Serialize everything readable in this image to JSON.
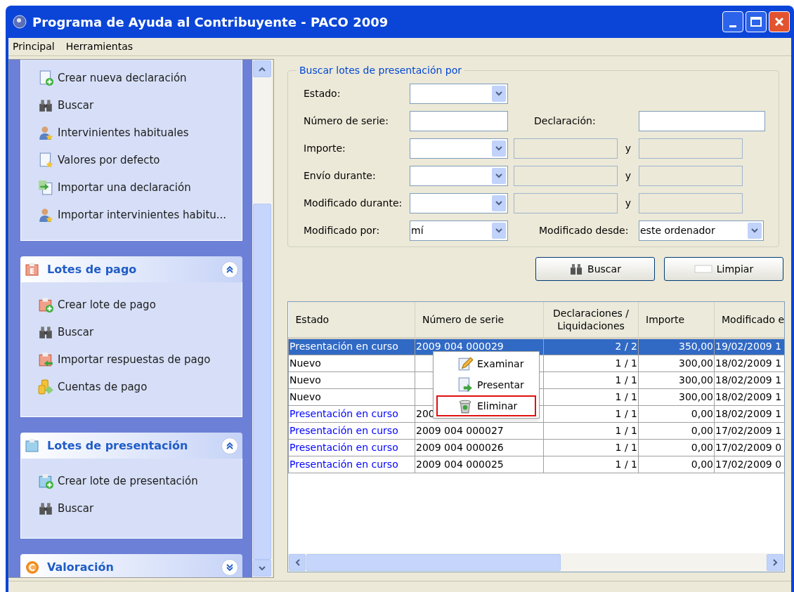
{
  "window": {
    "title": "Programa de Ayuda al Contribuyente - PACO 2009"
  },
  "menu_bar": [
    "Principal",
    "Herramientas"
  ],
  "sidebar": {
    "sections": [
      {
        "items": [
          "Crear nueva declaración",
          "Buscar",
          "Intervinientes habituales",
          "Valores por defecto",
          "Importar una declaración",
          "Importar intervinientes habitu..."
        ]
      },
      {
        "title": "Lotes de pago",
        "expanded": true,
        "items": [
          "Crear lote de pago",
          "Buscar",
          "Importar respuestas de pago",
          "Cuentas de pago"
        ]
      },
      {
        "title": "Lotes de presentación",
        "expanded": true,
        "items": [
          "Crear lote de presentación",
          "Buscar"
        ]
      },
      {
        "title": "Valoración",
        "expanded": false
      }
    ]
  },
  "search_form": {
    "legend": "Buscar lotes de presentación por",
    "estado": {
      "label": "Estado:"
    },
    "numero_serie": {
      "label": "Número de serie:"
    },
    "declaracion": {
      "label": "Declaración:"
    },
    "importe": {
      "label": "Importe:",
      "between": "y"
    },
    "envio_durante": {
      "label": "Envío durante:",
      "between": "y"
    },
    "modificado_durante": {
      "label": "Modificado durante:",
      "between": "y"
    },
    "modificado_por": {
      "label": "Modificado por:",
      "value": "mí"
    },
    "modificado_desde": {
      "label": "Modificado desde:",
      "value": "este ordenador"
    },
    "buttons": [
      "Buscar",
      "Limpiar"
    ]
  },
  "table": {
    "columns": [
      "Estado",
      "Número de serie",
      "Declaraciones / Liquidaciones",
      "Importe",
      "Modificado e"
    ],
    "rows": [
      {
        "selected": true,
        "color": "#ffffff",
        "cells": [
          "Presentación en curso",
          "2009 004 000029",
          "2 / 2",
          "350,00",
          "19/02/2009 1"
        ]
      },
      {
        "selected": false,
        "color": "#000000",
        "cells": [
          "Nuevo",
          "",
          "1 / 1",
          "300,00",
          "18/02/2009 1"
        ]
      },
      {
        "selected": false,
        "color": "#000000",
        "cells": [
          "Nuevo",
          "",
          "1 / 1",
          "300,00",
          "18/02/2009 1"
        ]
      },
      {
        "selected": false,
        "color": "#000000",
        "cells": [
          "Nuevo",
          "",
          "1 / 1",
          "300,00",
          "18/02/2009 1"
        ]
      },
      {
        "selected": false,
        "color": "#0000ff",
        "cells": [
          "Presentación en curso",
          "200",
          "1 / 1",
          "0,00",
          "18/02/2009 1"
        ]
      },
      {
        "selected": false,
        "color": "#0000ff",
        "cells": [
          "Presentación en curso",
          "2009 004 000027",
          "1 / 1",
          "0,00",
          "17/02/2009 1"
        ]
      },
      {
        "selected": false,
        "color": "#0000ff",
        "cells": [
          "Presentación en curso",
          "2009 004 000026",
          "1 / 1",
          "0,00",
          "17/02/2009 0"
        ]
      },
      {
        "selected": false,
        "color": "#0000ff",
        "cells": [
          "Presentación en curso",
          "2009 004 000025",
          "1 / 1",
          "0,00",
          "17/02/2009 0"
        ]
      }
    ]
  },
  "context_menu": [
    {
      "label": "Examinar",
      "highlighted": false
    },
    {
      "label": "Presentar",
      "highlighted": false
    },
    {
      "label": "Eliminar",
      "highlighted": true
    }
  ]
}
